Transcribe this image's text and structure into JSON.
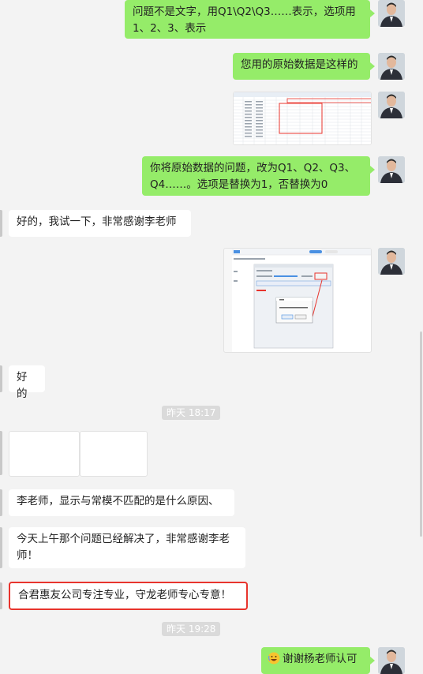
{
  "messages": {
    "m1_out": "问题不是文字，用Q1\\Q2\\Q3……表示，选项用1、2、3、表示",
    "m2_out": "您用的原始数据是这样的",
    "m4_out": "你将原始数据的问题，改为Q1、Q2、Q3、Q4……。选项是替换为1，否替换为0",
    "m5_in": "好的，我试一下，非常感谢李老师",
    "m7_in": "好的",
    "m9_in": "李老师，显示与常模不匹配的是什么原因、",
    "m10_in": "今天上午那个问题已经解决了，非常感谢李老师！",
    "m11_in": "合君惠友公司专注专业，守龙老师专心专意！",
    "m12_out": "谢谢杨老师认可"
  },
  "timestamps": {
    "t1": "昨天 18:17",
    "t2": "昨天 19:28"
  },
  "screenshot": {
    "dialog_title": "提示",
    "dialog_ok": "确定",
    "red_label": "导入结果"
  },
  "icons": {
    "emoji": "grinning-emoji-icon"
  }
}
